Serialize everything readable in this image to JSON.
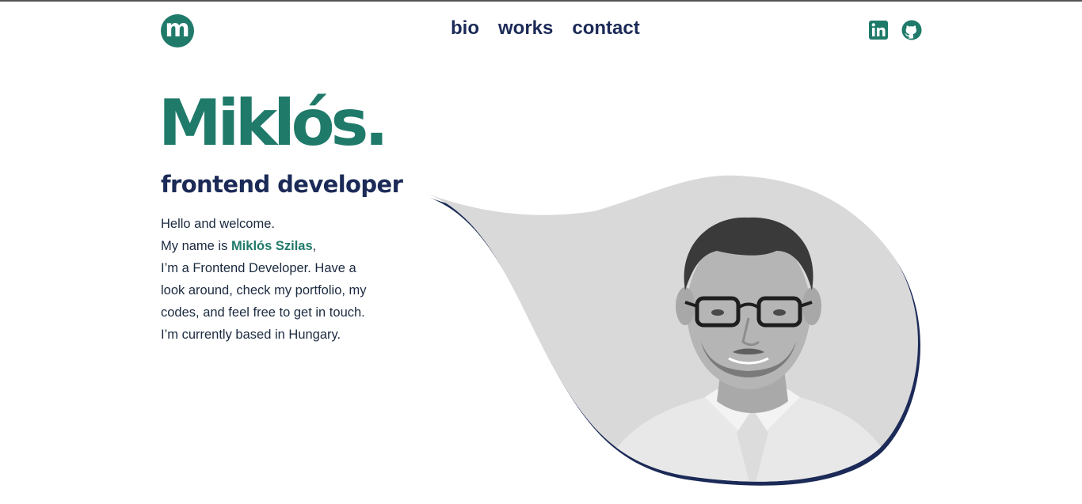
{
  "header": {
    "logo_letter": "m",
    "nav": [
      {
        "label": "bio"
      },
      {
        "label": "works"
      },
      {
        "label": "contact"
      }
    ],
    "social": [
      {
        "icon": "linkedin-icon"
      },
      {
        "icon": "github-icon"
      }
    ]
  },
  "hero": {
    "name": "Miklós.",
    "role": "frontend developer",
    "intro": {
      "line1": "Hello and welcome.",
      "line2_prefix": "My name is ",
      "line2_name": "Miklós Szilas",
      "line2_suffix": ",",
      "line3": "I’m a Frontend Developer. Have a",
      "line4": "look around, check my portfolio, my",
      "line5": "codes, and feel free to get in touch.",
      "line6": "I’m currently based in Hungary."
    },
    "portrait": "portrait photo (grayscale)"
  },
  "colors": {
    "accent": "#1f7a6a",
    "navy": "#1b2a57",
    "blob_fill": "#d9d9d9"
  }
}
